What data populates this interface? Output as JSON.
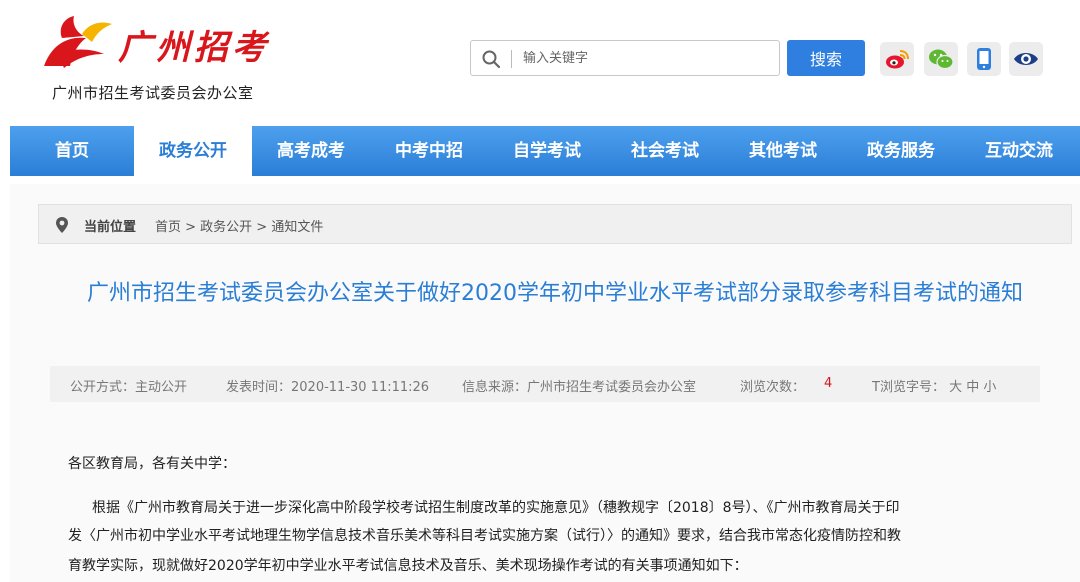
{
  "header": {
    "logo_script": "广州招考",
    "logo_sub": "广州市招生考试委员会办公室",
    "search": {
      "placeholder": "输入关键字",
      "button_label": "搜索"
    },
    "social": [
      "weibo-icon",
      "wechat-icon",
      "mobile-icon",
      "eye-icon"
    ]
  },
  "nav": {
    "items": [
      {
        "label": "首页"
      },
      {
        "label": "政务公开"
      },
      {
        "label": "高考成考"
      },
      {
        "label": "中考中招"
      },
      {
        "label": "自学考试"
      },
      {
        "label": "社会考试"
      },
      {
        "label": "其他考试"
      },
      {
        "label": "政务服务"
      },
      {
        "label": "互动交流"
      }
    ],
    "active": "政务公开"
  },
  "breadcrumb": {
    "label": "当前位置",
    "path": "首页 > 政务公开 > 通知文件"
  },
  "article": {
    "title": "广州市招生考试委员会办公室关于做好2020学年初中学业水平考试部分录取参考科目考试的通知",
    "meta": {
      "mode": "公开方式：主动公开",
      "time": "发表时间：2020-11-30 11:11:26",
      "source": "信息来源：广州市招生考试委员会办公室",
      "views_label": "浏览次数：",
      "views_count": "4",
      "font_size": "T浏览字号： 大  中  小"
    },
    "salutation": "各区教育局，各有关中学：",
    "paragraph_line1": "根据《广州市教育局关于进一步深化高中阶段学校考试招生制度改革的实施意见》（穗教规字〔2018〕8号）、《广州市教育局关于印",
    "paragraph_line2": "发〈广州市初中学业水平考试地理生物学信息技术音乐美术等科目考试实施方案（试行）〉的通知》要求，结合我市常态化疫情防控和教",
    "paragraph_line3": "育教学实际，现就做好2020学年初中学业水平考试信息技术及音乐、美术现场操作考试的有关事项通知如下："
  },
  "colors": {
    "brand_red": "#d8161b",
    "nav_blue": "#2a7ed6",
    "button_blue": "#2f7fe0",
    "title_blue": "#2a7ed6"
  }
}
